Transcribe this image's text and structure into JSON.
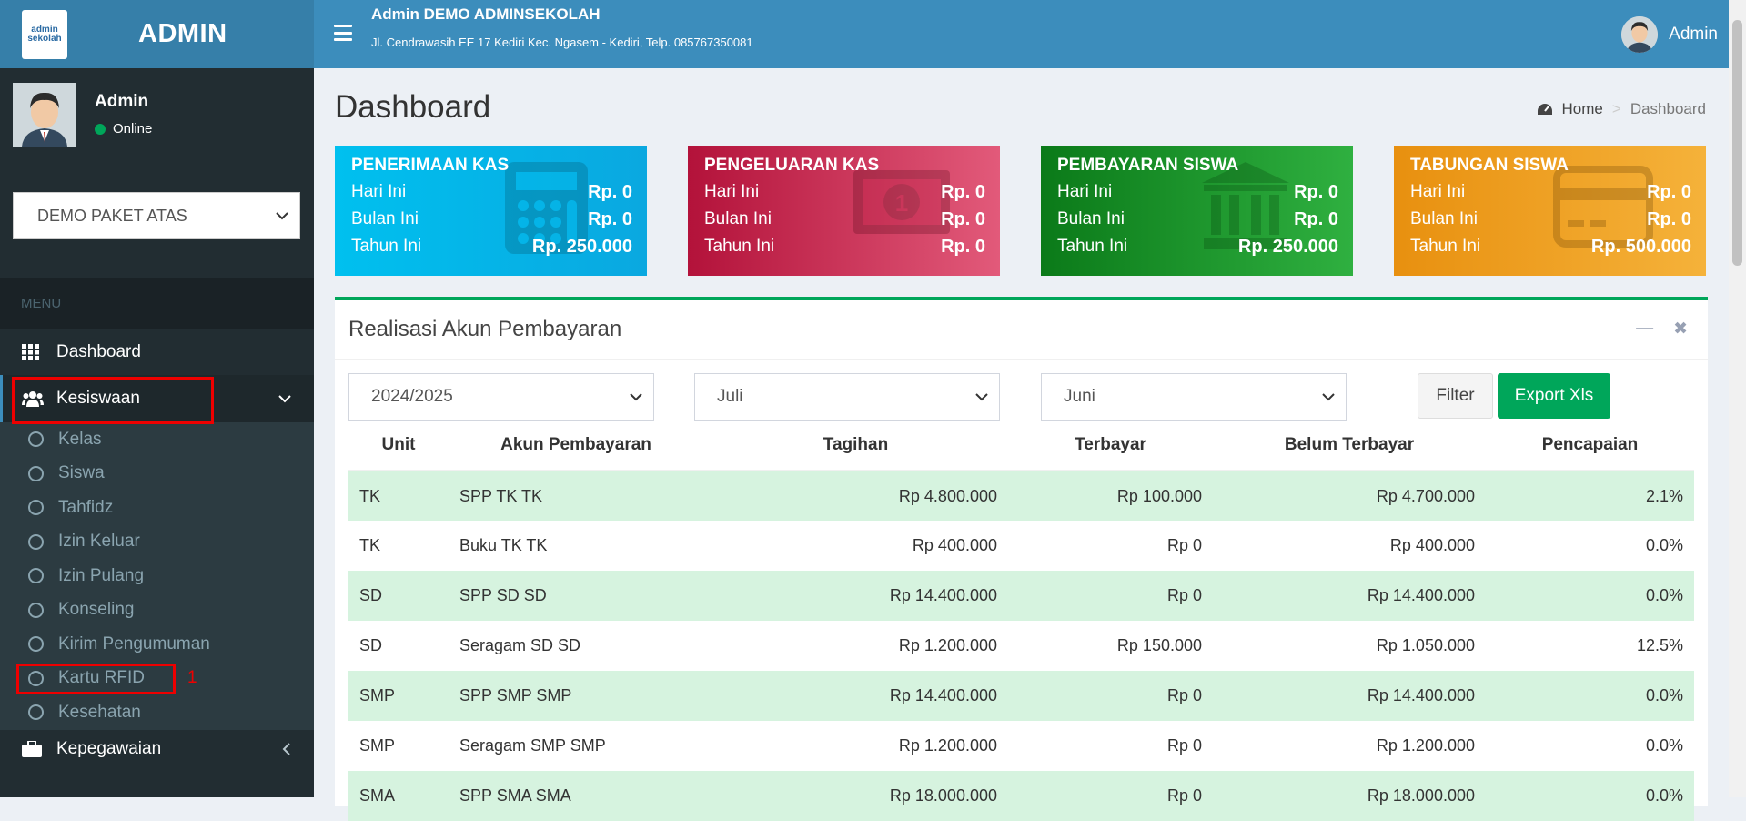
{
  "brand": {
    "logo_line1": "admin",
    "logo_line2": "sekolah",
    "title": "ADMIN"
  },
  "user": {
    "name": "Admin",
    "status": "Online"
  },
  "school_select": {
    "value": "DEMO PAKET ATAS"
  },
  "menu": {
    "header": "MENU",
    "dashboard": "Dashboard",
    "kesiswaan": "Kesiswaan",
    "kesiswaan_sub": [
      "Kelas",
      "Siswa",
      "Tahfidz",
      "Izin Keluar",
      "Izin Pulang",
      "Konseling",
      "Kirim Pengumuman",
      "Kartu RFID",
      "Kesehatan"
    ],
    "kepegawaian": "Kepegawaian",
    "annotation": "1"
  },
  "topbar": {
    "school_name": "Admin DEMO ADMINSEKOLAH",
    "school_address": "Jl. Cendrawasih EE 17 Kediri Kec. Ngasem - Kediri, Telp. 085767350081",
    "user": "Admin"
  },
  "page": {
    "title": "Dashboard",
    "breadcrumb_home": "Home",
    "breadcrumb_current": "Dashboard"
  },
  "cards": [
    {
      "title": "PENERIMAAN KAS",
      "labels": [
        "Hari Ini",
        "Bulan Ini",
        "Tahun Ini"
      ],
      "values": [
        "Rp. 0",
        "Rp. 0",
        "Rp. 250.000"
      ],
      "color": "#00c0ef",
      "icon": "calculator-icon"
    },
    {
      "title": "PENGELUARAN KAS",
      "labels": [
        "Hari Ini",
        "Bulan Ini",
        "Tahun Ini"
      ],
      "values": [
        "Rp. 0",
        "Rp. 0",
        "Rp. 0"
      ],
      "color": "#dd4b39",
      "icon": "money-icon"
    },
    {
      "title": "PEMBAYARAN SISWA",
      "labels": [
        "Hari Ini",
        "Bulan Ini",
        "Tahun Ini"
      ],
      "values": [
        "Rp. 0",
        "Rp. 0",
        "Rp. 250.000"
      ],
      "color": "#00a65a",
      "icon": "bank-icon"
    },
    {
      "title": "TABUNGAN SISWA",
      "labels": [
        "Hari Ini",
        "Bulan Ini",
        "Tahun Ini"
      ],
      "values": [
        "Rp. 0",
        "Rp. 0",
        "Rp. 500.000"
      ],
      "color": "#f39c12",
      "icon": "credit-card-icon"
    }
  ],
  "realisasi": {
    "title": "Realisasi Akun Pembayaran",
    "year": "2024/2025",
    "month_from": "Juli",
    "month_to": "Juni",
    "filter_label": "Filter",
    "export_label": "Export Xls",
    "columns": [
      "Unit",
      "Akun Pembayaran",
      "Tagihan",
      "Terbayar",
      "Belum Terbayar",
      "Pencapaian"
    ],
    "rows": [
      [
        "TK",
        "SPP TK TK",
        "Rp 4.800.000",
        "Rp 100.000",
        "Rp 4.700.000",
        "2.1%"
      ],
      [
        "TK",
        "Buku TK TK",
        "Rp 400.000",
        "Rp 0",
        "Rp 400.000",
        "0.0%"
      ],
      [
        "SD",
        "SPP SD SD",
        "Rp 14.400.000",
        "Rp 0",
        "Rp 14.400.000",
        "0.0%"
      ],
      [
        "SD",
        "Seragam SD SD",
        "Rp 1.200.000",
        "Rp 150.000",
        "Rp 1.050.000",
        "12.5%"
      ],
      [
        "SMP",
        "SPP SMP SMP",
        "Rp 14.400.000",
        "Rp 0",
        "Rp 14.400.000",
        "0.0%"
      ],
      [
        "SMP",
        "Seragam SMP SMP",
        "Rp 1.200.000",
        "Rp 0",
        "Rp 1.200.000",
        "0.0%"
      ],
      [
        "SMA",
        "SPP SMA SMA",
        "Rp 18.000.000",
        "Rp 0",
        "Rp 18.000.000",
        "0.0%"
      ]
    ]
  }
}
